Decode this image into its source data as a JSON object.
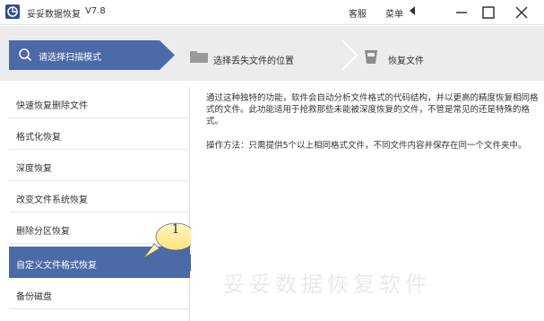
{
  "app": {
    "name": "妥妥数据恢复",
    "version": "V7.8"
  },
  "titlebar": {
    "service_label": "客服",
    "menu_label": "菜单"
  },
  "steps": [
    {
      "label": "请选择扫描模式",
      "icon": "search-icon",
      "active": true
    },
    {
      "label": "选择丢失文件的位置",
      "icon": "folder-icon",
      "active": false
    },
    {
      "label": "恢复文件",
      "icon": "recover-bin-icon",
      "active": false
    }
  ],
  "sidebar": {
    "items": [
      {
        "label": "快速恢复删除文件"
      },
      {
        "label": "格式化恢复"
      },
      {
        "label": "深度恢复"
      },
      {
        "label": "改变文件系统恢复"
      },
      {
        "label": "删除分区恢复"
      },
      {
        "label": "自定义文件格式恢复",
        "selected": true
      },
      {
        "label": "备份磁盘"
      }
    ]
  },
  "callout": {
    "number": "1"
  },
  "content": {
    "description": "通过这种独特的功能，软件会自动分析文件格式的代码结构，并以更高的精度恢复相同格式的文件。此功能适用于抢救那些未能被深度恢复的文件，不管是常见的还是特殊的格式。",
    "method": "操作方法：只需提供5个以上相同格式文件，不同文件内容并保存在同一个文件夹中。",
    "watermark": "妥妥数据恢复软件"
  },
  "colors": {
    "accent": "#4b6aa7",
    "step_bar": "#ececec",
    "logo": "#2e4d8f"
  }
}
